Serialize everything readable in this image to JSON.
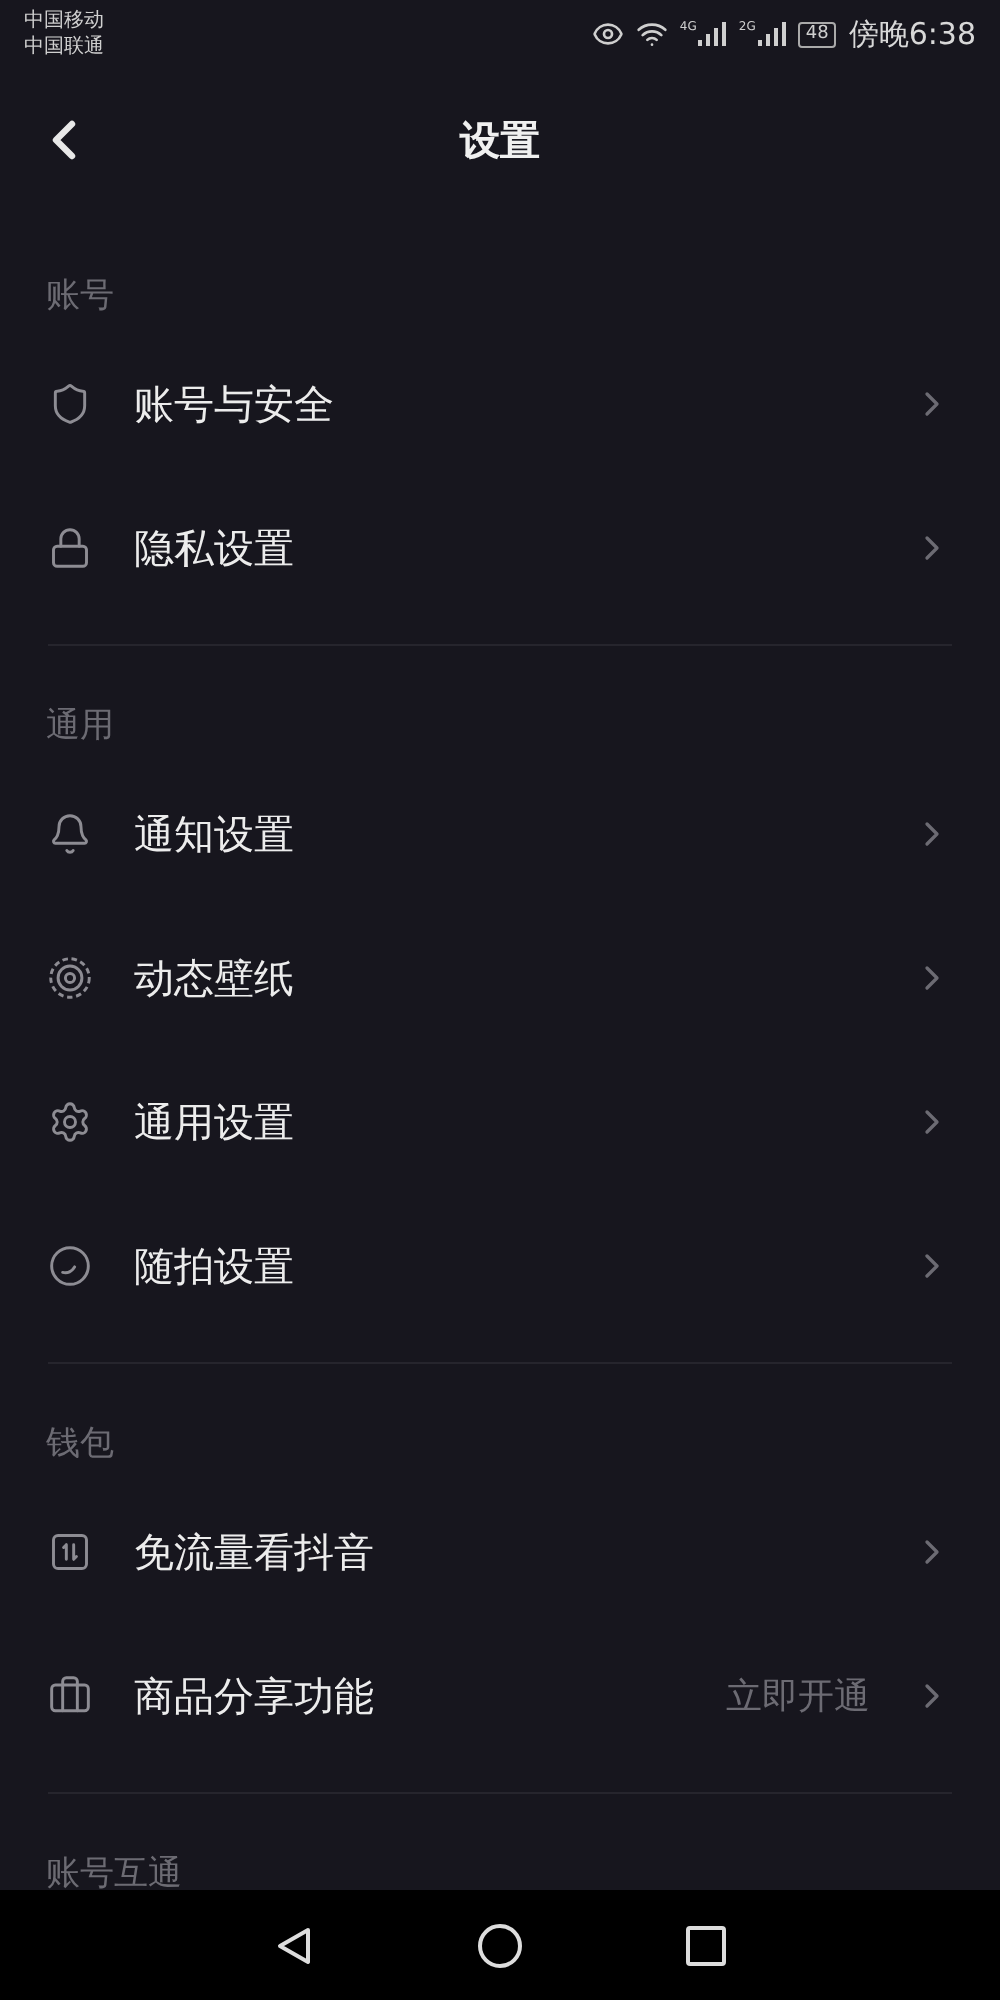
{
  "status_bar": {
    "carriers": [
      "中国移动",
      "中国联通"
    ],
    "network_1": "4G",
    "network_2": "2G",
    "battery": "48",
    "time": "傍晚6:38"
  },
  "header": {
    "title": "设置"
  },
  "sections": [
    {
      "title": "账号",
      "items": [
        {
          "kind": "shield",
          "label": "账号与安全"
        },
        {
          "kind": "lock",
          "label": "隐私设置"
        }
      ]
    },
    {
      "title": "通用",
      "items": [
        {
          "kind": "bell",
          "label": "通知设置"
        },
        {
          "kind": "wallpaper",
          "label": "动态壁纸"
        },
        {
          "kind": "gear",
          "label": "通用设置"
        },
        {
          "kind": "camera",
          "label": "随拍设置"
        }
      ]
    },
    {
      "title": "钱包",
      "items": [
        {
          "kind": "data",
          "label": "免流量看抖音"
        },
        {
          "kind": "briefcase",
          "label": "商品分享功能",
          "value": "立即开通"
        }
      ]
    },
    {
      "title": "账号互通"
    }
  ]
}
